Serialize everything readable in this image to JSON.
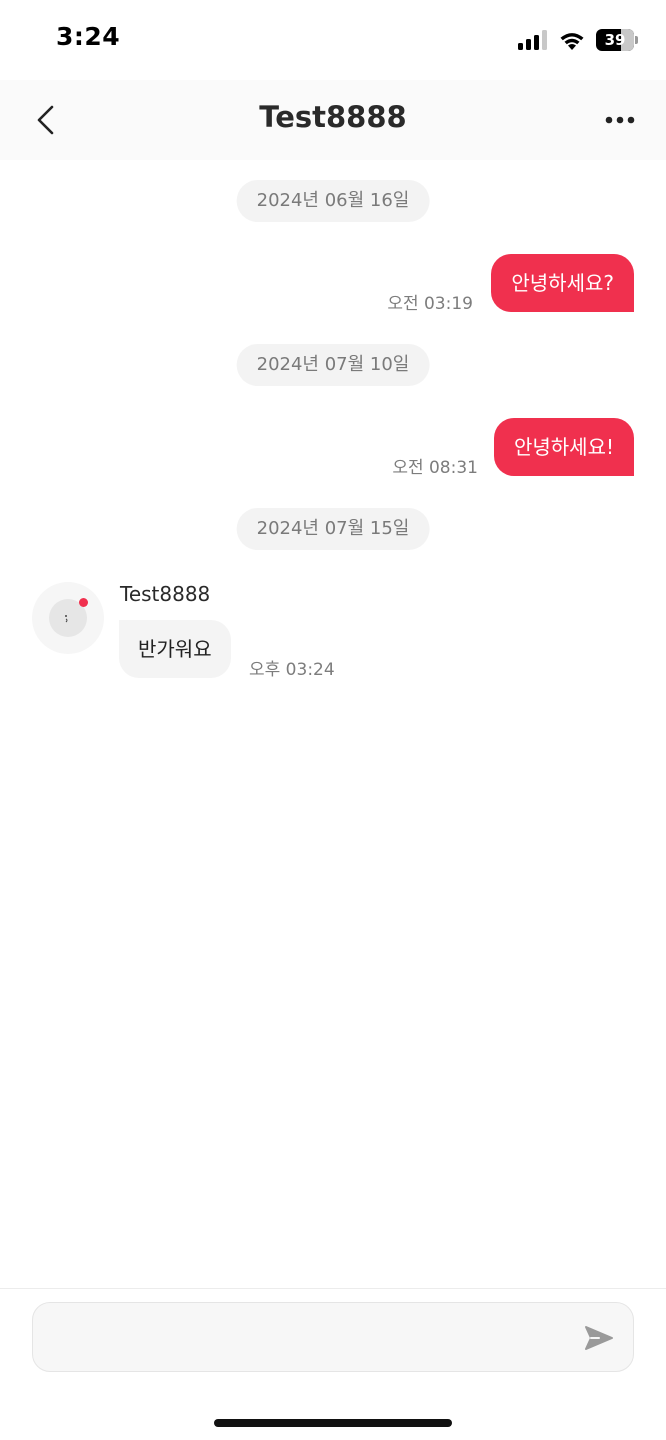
{
  "status_bar": {
    "time": "3:24",
    "battery": "39",
    "icons": [
      "signal-icon",
      "wifi-icon",
      "battery-icon"
    ]
  },
  "header": {
    "title": "Test8888",
    "back_icon": "chevron-left-icon",
    "more_icon": "more-horizontal-icon"
  },
  "chat": {
    "dates": [
      "2024년 06월 16일",
      "2024년 07월 10일",
      "2024년 07월 15일"
    ],
    "outgoing": [
      {
        "text": "안녕하세요?",
        "time": "오전 03:19"
      },
      {
        "text": "안녕하세요!",
        "time": "오전 08:31"
      }
    ],
    "incoming": [
      {
        "sender": "Test8888",
        "text": "반가워요",
        "time": "오후 03:24"
      }
    ]
  },
  "composer": {
    "placeholder": "",
    "send_icon": "send-icon"
  },
  "colors": {
    "accent": "#f0304e",
    "incoming_bubble": "#f4f4f4",
    "date_pill": "#f3f3f3"
  }
}
